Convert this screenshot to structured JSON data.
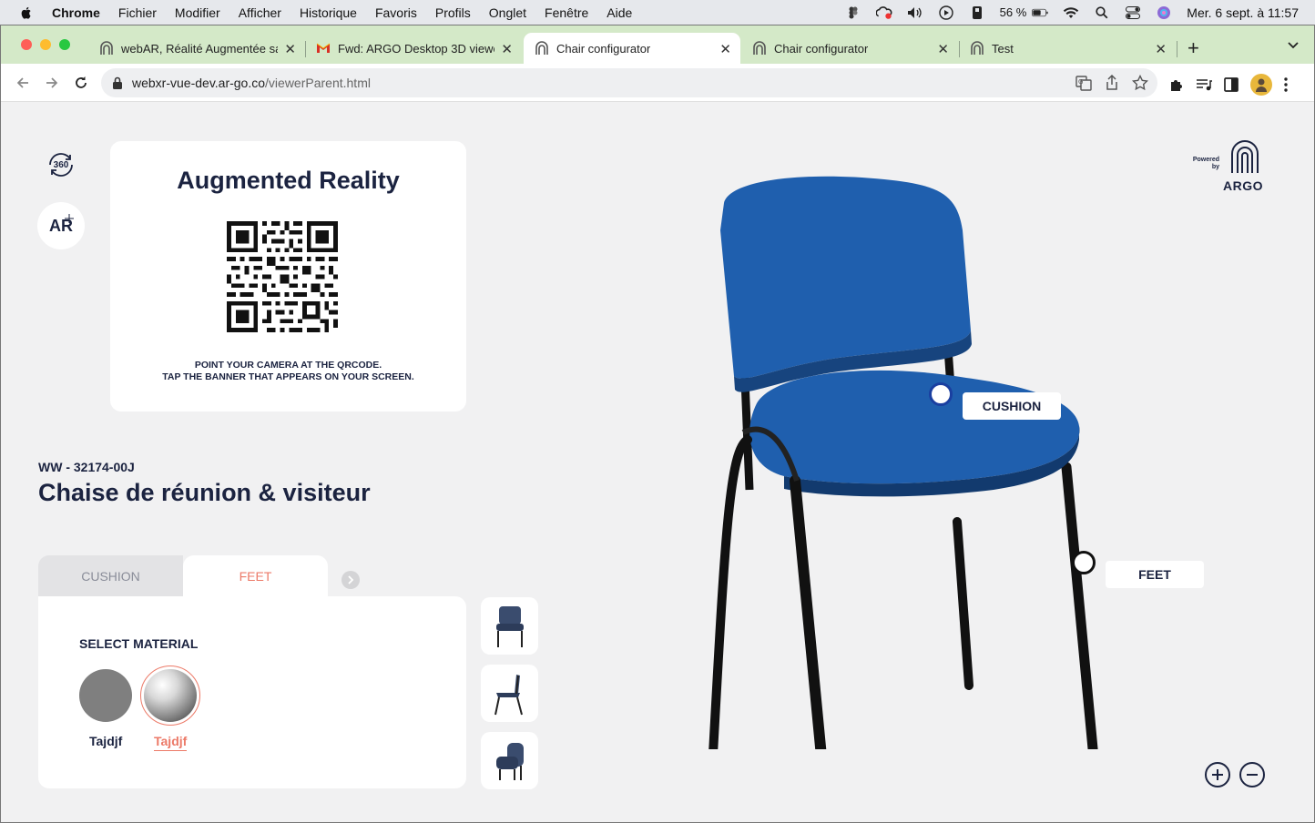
{
  "menubar": {
    "app": "Chrome",
    "items": [
      "Fichier",
      "Modifier",
      "Afficher",
      "Historique",
      "Favoris",
      "Profils",
      "Onglet",
      "Fenêtre",
      "Aide"
    ],
    "battery": "56 %",
    "clock": "Mer. 6 sept. à 11:57"
  },
  "tabs": [
    {
      "title": "webAR, Réalité Augmentée sar",
      "favicon": "argo-icon"
    },
    {
      "title": "Fwd: ARGO Desktop 3D viewer",
      "favicon": "gmail-icon"
    },
    {
      "title": "Chair configurator",
      "favicon": "argo-icon",
      "active": true
    },
    {
      "title": "Chair configurator",
      "favicon": "argo-icon"
    },
    {
      "title": "Test",
      "favicon": "argo-icon"
    }
  ],
  "address": {
    "host": "webxr-vue-dev.ar-go.co",
    "path": "/viewerParent.html"
  },
  "viewer": {
    "btn_360": "360",
    "btn_ar": "AR",
    "ar_card": {
      "title": "Augmented Reality",
      "line1": "POINT YOUR CAMERA AT THE QRCODE.",
      "line2": "TAP THE BANNER THAT APPEARS ON YOUR SCREEN."
    },
    "product": {
      "code": "WW - 32174-00J",
      "name": "Chaise de réunion & visiteur"
    },
    "config_tabs": [
      "CUSHION",
      "FEET"
    ],
    "active_tab": "FEET",
    "select_material": "SELECT MATERIAL",
    "materials": [
      {
        "label": "Tajdjf",
        "color": "#7f7f7f"
      },
      {
        "label": "Tajdjf",
        "color": "#c8c8c8",
        "selected": true
      }
    ],
    "hotspots": {
      "cushion": "CUSHION",
      "feet": "FEET"
    },
    "logo": {
      "powered": "Powered",
      "by": "by",
      "name": "ARGO"
    },
    "colors": {
      "accent": "#ec7a68",
      "navy": "#1b2340",
      "chair_blue": "#1f5fae"
    }
  }
}
